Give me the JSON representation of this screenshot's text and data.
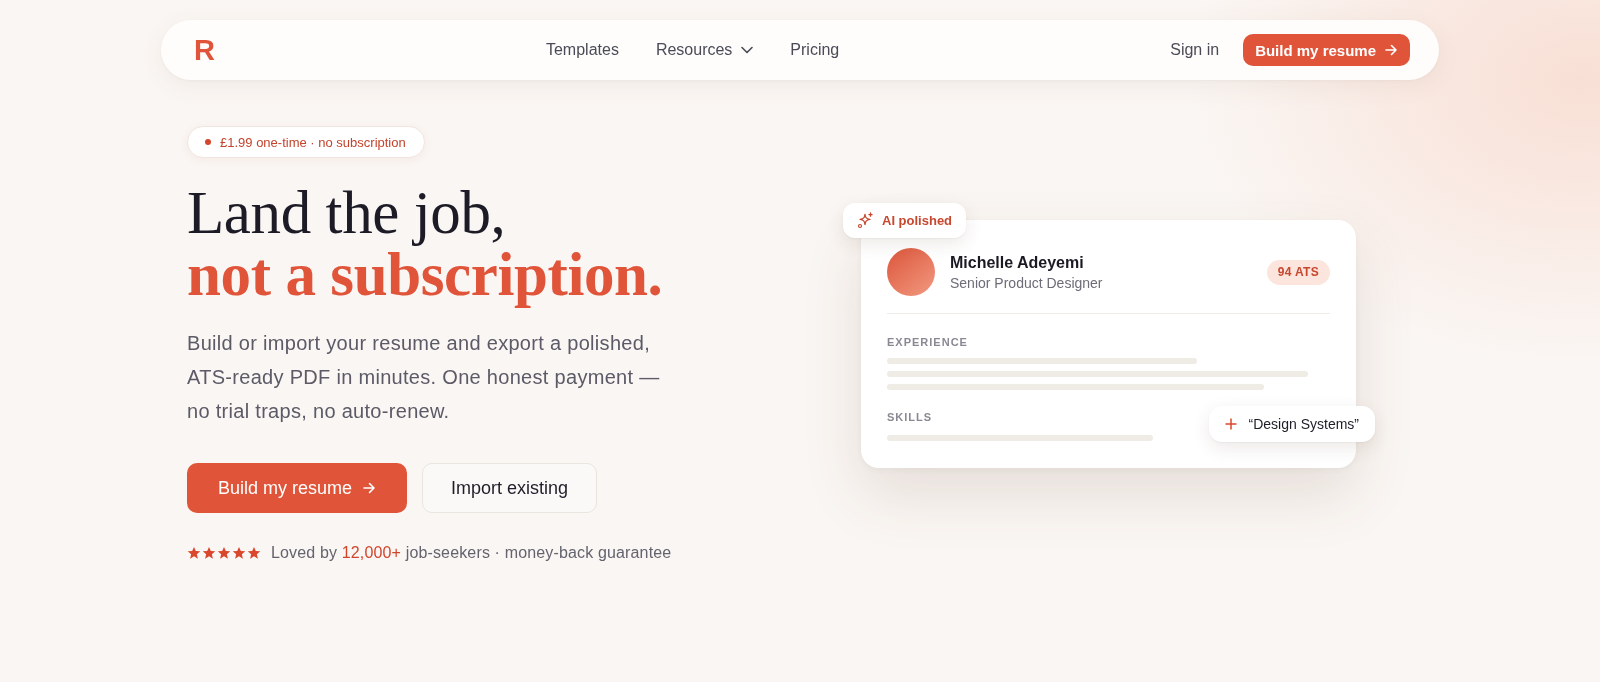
{
  "nav": {
    "logo": "R",
    "links": [
      {
        "label": "Templates",
        "dropdown": false
      },
      {
        "label": "Resources",
        "dropdown": true
      },
      {
        "label": "Pricing",
        "dropdown": false
      }
    ],
    "sign_in": "Sign in",
    "cta": "Build my resume"
  },
  "hero": {
    "badge": "£1.99 one-time · no subscription",
    "headline": "Land the job, **not a subscription.**",
    "description": "Build or import your resume and export a polished, ATS-ready PDF in minutes. One honest payment — no trial traps, no auto-renew.",
    "buttons": [
      {
        "label": "Build my resume",
        "kind": "primary"
      },
      {
        "label": "Import existing",
        "kind": "secondary"
      }
    ],
    "rating": {
      "stars": 5,
      "text": "Loved by **12,000+** job-seekers · money-back guarantee"
    }
  },
  "preview": {
    "tag": "AI polished",
    "name": "Michelle Adeyemi",
    "role": "Senior Product Designer",
    "score": "94 ATS",
    "sections": [
      {
        "title": "EXPERIENCE"
      },
      {
        "title": "SKILLS"
      }
    ],
    "suggestion": "“Design Systems”"
  }
}
